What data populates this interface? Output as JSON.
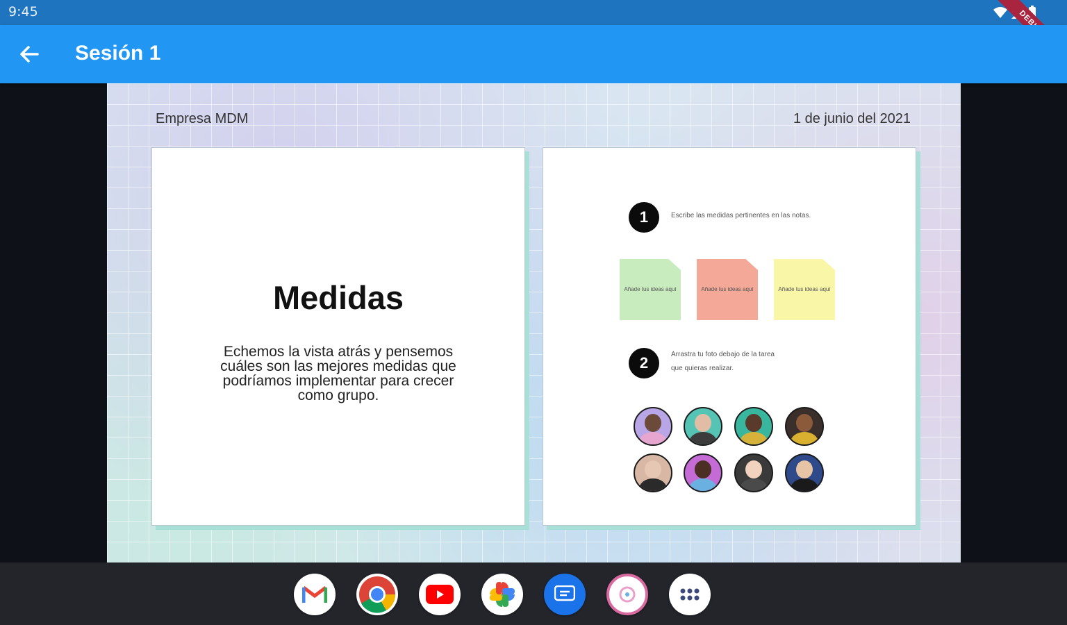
{
  "status_bar": {
    "time": "9:45",
    "debug_banner": "DEBUG"
  },
  "app_bar": {
    "title": "Sesión 1"
  },
  "header": {
    "company": "Empresa MDM",
    "date": "1 de junio del 2021"
  },
  "slide_left": {
    "title": "Medidas",
    "body": "Echemos la vista atrás y pensemos cuáles son las mejores medidas que podríamos implementar para crecer como grupo."
  },
  "slide_right": {
    "step1": {
      "number": "1",
      "text": "Escribe las medidas pertinentes en las notas."
    },
    "notes": [
      {
        "text": "Añade tus ideas aquí",
        "color": "#c9ecbf"
      },
      {
        "text": "Añade tus ideas aquí",
        "color": "#f4a898"
      },
      {
        "text": "Añade tus ideas aquí",
        "color": "#f9f6a8"
      }
    ],
    "step2": {
      "number": "2",
      "text_line1": "Arrastra tu foto debajo de la tarea",
      "text_line2": "que quieras realizar."
    },
    "avatars": [
      {
        "name": "avatar-1",
        "bg": "#b9a6e6",
        "skin": "#6b4a3a",
        "cloth": "#e6a6d0"
      },
      {
        "name": "avatar-2",
        "bg": "#55c4b5",
        "skin": "#e2bda5",
        "cloth": "#3c3c3c"
      },
      {
        "name": "avatar-3",
        "bg": "#39b79e",
        "skin": "#5a3a2a",
        "cloth": "#d7b23a"
      },
      {
        "name": "avatar-4",
        "bg": "#3a2f2a",
        "skin": "#8a5a3a",
        "cloth": "#d9b030"
      },
      {
        "name": "avatar-5",
        "bg": "#d8b7a4",
        "skin": "#e6c7b4",
        "cloth": "#2a2a2a"
      },
      {
        "name": "avatar-6",
        "bg": "#c46bd6",
        "skin": "#4b2f25",
        "cloth": "#6ab0e0"
      },
      {
        "name": "avatar-7",
        "bg": "#3a3a3a",
        "skin": "#f0d2bf",
        "cloth": "#4a4a4a"
      },
      {
        "name": "avatar-8",
        "bg": "#2f4a8a",
        "skin": "#e8c4a6",
        "cloth": "#1a1a1a"
      }
    ]
  },
  "dock": [
    {
      "name": "gmail-icon"
    },
    {
      "name": "chrome-icon"
    },
    {
      "name": "youtube-icon"
    },
    {
      "name": "photos-icon"
    },
    {
      "name": "messages-icon"
    },
    {
      "name": "app-circle-icon"
    },
    {
      "name": "apps-grid-icon"
    }
  ]
}
